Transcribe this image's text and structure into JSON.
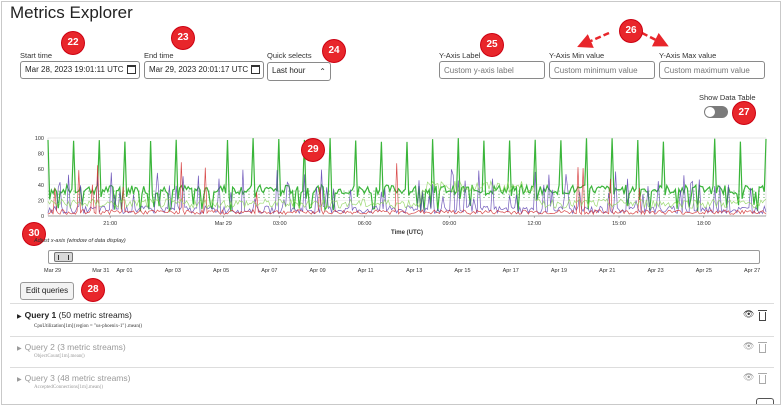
{
  "title": "Metrics Explorer",
  "fields": {
    "start_time": {
      "label": "Start time",
      "value": "Mar 28, 2023 19:01:11 UTC",
      "badge": "22"
    },
    "end_time": {
      "label": "End time",
      "value": "Mar 29, 2023 20:01:17 UTC",
      "badge": "23"
    },
    "quick_selects": {
      "label": "Quick selects",
      "value": "Last hour",
      "badge": "24"
    },
    "y_axis_label": {
      "label": "Y-Axis Label",
      "placeholder": "Custom y-axis label",
      "badge": "25"
    },
    "y_axis_min": {
      "label": "Y-Axis Min value",
      "placeholder": "Custom minimum value"
    },
    "y_axis_max": {
      "label": "Y-Axis Max value",
      "placeholder": "Custom maximum value"
    },
    "y_axis_minmax_badge": "26"
  },
  "data_table": {
    "label": "Show Data Table",
    "badge": "27",
    "checked": false
  },
  "chart_data": {
    "type": "line",
    "xlabel": "Time (UTC)",
    "ylabel": "",
    "ylim": [
      0,
      100
    ],
    "yticks": [
      0,
      20,
      40,
      60,
      80,
      100
    ],
    "xticks": [
      "21:00",
      "Mar 29",
      "03:00",
      "06:00",
      "09:00",
      "12:00",
      "15:00",
      "18:00"
    ],
    "x_hours": [
      2,
      6,
      8,
      11,
      14,
      17,
      20,
      23
    ],
    "x_range_hours": [
      -0.2,
      25.2
    ],
    "series": [
      {
        "color": "#2fb12f",
        "values": []
      },
      {
        "color": "#5b3fb0",
        "values": []
      },
      {
        "color": "#d22b2b",
        "values": []
      },
      {
        "color": "#8bd35a",
        "values": []
      }
    ],
    "badge": "29"
  },
  "range": {
    "label": "Adjust x-axis (window of data display)",
    "badge": "30",
    "dates": [
      "Mar 29",
      "Mar 31",
      "Apr 01",
      "Apr 03",
      "Apr 05",
      "Apr 07",
      "Apr 09",
      "Apr 11",
      "Apr 13",
      "Apr 15",
      "Apr 17",
      "Apr 19",
      "Apr 21",
      "Apr 23",
      "Apr 25",
      "Apr 27"
    ],
    "day_offsets": [
      0,
      2,
      3,
      5,
      7,
      9,
      11,
      13,
      15,
      17,
      19,
      21,
      23,
      25,
      27,
      29
    ]
  },
  "edit_queries": {
    "label": "Edit queries",
    "badge": "28"
  },
  "queries": [
    {
      "name": "Query 1",
      "count": "(50 metric streams)",
      "expr": "CpuUtilization[1m]{region = \"us-phoenix-1\"}.mean()",
      "active": true
    },
    {
      "name": "Query 2",
      "count": "(3 metric streams)",
      "expr": "ObjectCount[1m].mean()",
      "active": false
    },
    {
      "name": "Query 3",
      "count": "(48 metric streams)",
      "expr": "AcceptedConnections[1m].mean()",
      "active": false
    }
  ]
}
